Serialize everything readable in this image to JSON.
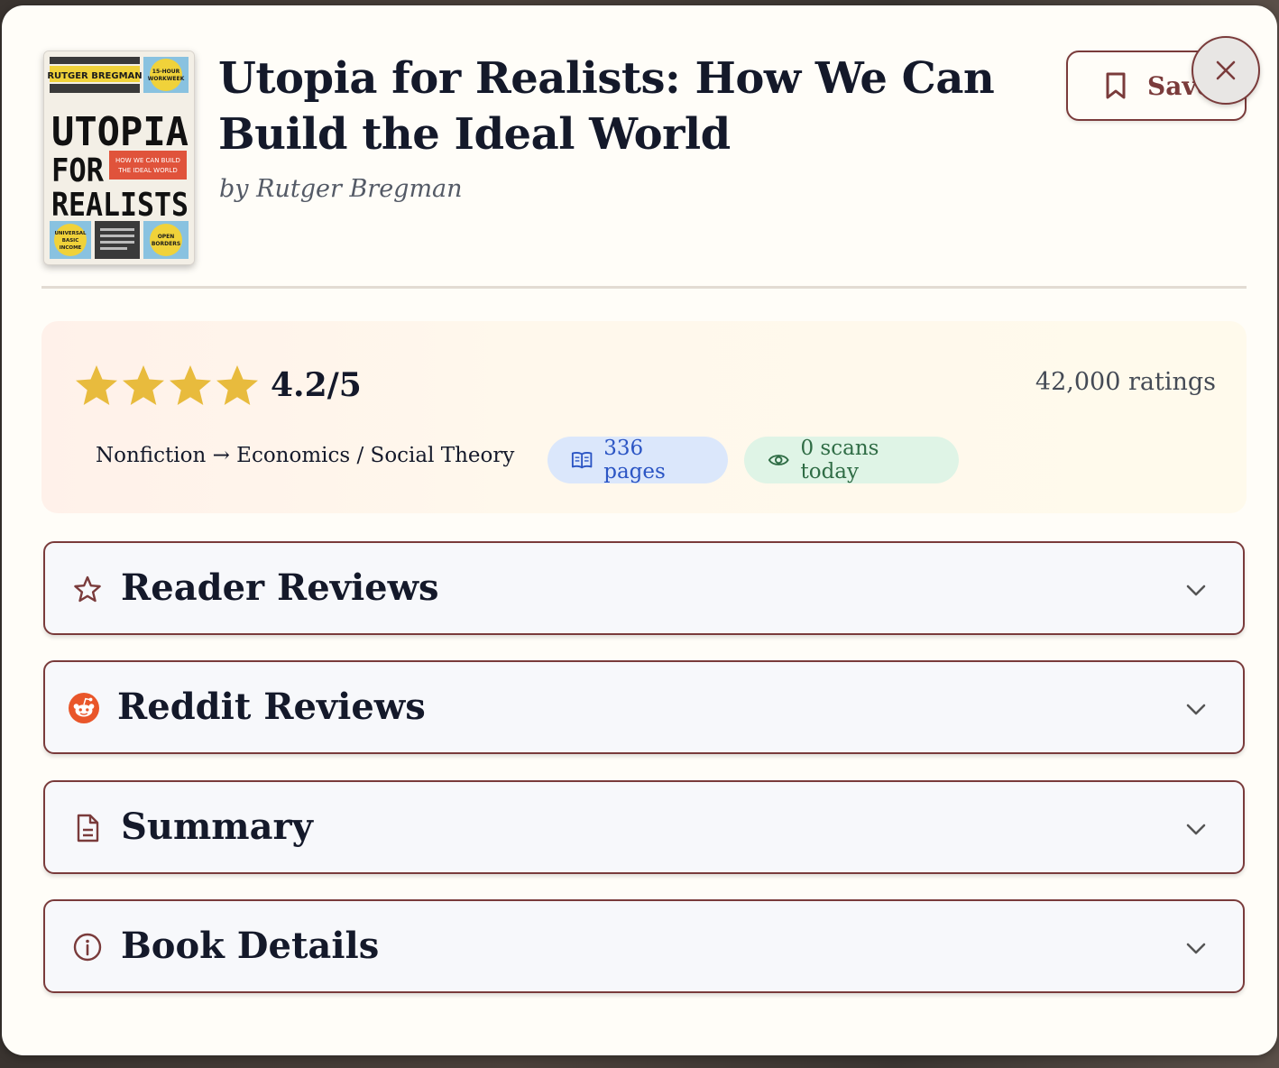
{
  "book": {
    "title": "Utopia for Realists: How We Can Build the Ideal World",
    "author_line": "by Rutger Bregman",
    "cover": {
      "author": "RUTGER BREGMAN",
      "title_line1": "UTOPIA",
      "title_line2": "FOR",
      "title_line3": "REALISTS",
      "subtitle_line1": "HOW WE CAN BUILD",
      "subtitle_line2": "THE IDEAL WORLD",
      "badge_top": "15-HOUR WORKWEEK",
      "badge_bottom_left": "UNIVERSAL BASIC INCOME",
      "badge_bottom_right": "OPEN BORDERS"
    }
  },
  "actions": {
    "save_label": "Save",
    "close_icon": "close-icon",
    "save_icon": "bookmark-icon"
  },
  "rating": {
    "stars_filled": 4,
    "stars_total": 4,
    "star_color": "#e8bb3d",
    "value_text": "4.2/5",
    "count_text": "42,000 ratings"
  },
  "meta": {
    "genre": "Nonfiction → Economics / Social Theory",
    "pages_text": "336 pages",
    "pages_icon": "book-open-icon",
    "scans_text": "0 scans today",
    "scans_icon": "eye-icon"
  },
  "sections": [
    {
      "label": "Reader Reviews",
      "icon": "star-outline-icon"
    },
    {
      "label": "Reddit Reviews",
      "icon": "reddit-icon"
    },
    {
      "label": "Summary",
      "icon": "document-icon"
    },
    {
      "label": "Book Details",
      "icon": "info-icon"
    }
  ],
  "colors": {
    "accent": "#7a3b3b",
    "title_text": "#14192a",
    "pages_pill_bg": "#dbe7fb",
    "pages_pill_text": "#2b55c4",
    "scans_pill_bg": "#dff4e6",
    "scans_pill_text": "#2f6c45",
    "reddit_orange": "#e9562a"
  }
}
